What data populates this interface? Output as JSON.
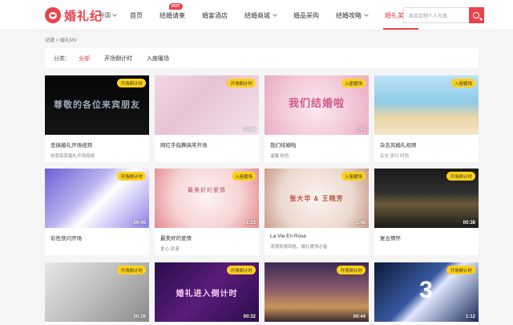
{
  "header": {
    "logo_text": "婚礼纪",
    "city": "全国",
    "nav": [
      {
        "label": "首页",
        "dropdown": false,
        "active": false,
        "hot": false
      },
      {
        "label": "结婚请柬",
        "dropdown": false,
        "active": false,
        "hot": true
      },
      {
        "label": "婚宴酒店",
        "dropdown": false,
        "active": false,
        "hot": false
      },
      {
        "label": "结婚商城",
        "dropdown": true,
        "active": false,
        "hot": false
      },
      {
        "label": "婚品采购",
        "dropdown": false,
        "active": false,
        "hot": false
      },
      {
        "label": "结婚攻略",
        "dropdown": true,
        "active": false,
        "hot": false
      },
      {
        "label": "婚礼美图",
        "dropdown": true,
        "active": true,
        "hot": false
      }
    ],
    "hot_badge": "HOT",
    "search_placeholder": "商品定制个人写真"
  },
  "breadcrumb": "动漫 > 婚礼MV",
  "filter": {
    "label": "分类：",
    "options": [
      "全部",
      "开场倒计时",
      "入座暖场"
    ],
    "active_index": 0
  },
  "cards": [
    {
      "title": "恶搞婚礼开场视频",
      "tags": "创意搞笑婚礼开场视频",
      "tag": "开场倒计时",
      "duration": "",
      "overlay": "尊敬的各位来宾朋友"
    },
    {
      "title": "网红手指舞搞笑开场",
      "tags": "",
      "tag": "开场倒计时",
      "duration": "00:46",
      "overlay": ""
    },
    {
      "title": "我们结婚啦",
      "tags": "温馨 粉色",
      "tag": "入座暖场",
      "duration": "1:47",
      "overlay": "我们结婚啦"
    },
    {
      "title": "杂志风婚礼视频",
      "tags": "杂志 流行 时尚",
      "tag": "入座暖场",
      "duration": "",
      "overlay": ""
    },
    {
      "title": "彩色快闪开场",
      "tags": "",
      "tag": "开场倒计时",
      "duration": "00:45",
      "overlay": ""
    },
    {
      "title": "最美好的爱情",
      "tags": "爱心 浪漫",
      "tag": "入座暖场",
      "duration": "1:23",
      "overlay": "最美好的爱情"
    },
    {
      "title": "La Vie En Rose",
      "tags": "浪漫玫瑰风格，婚礼暖场必备",
      "tag": "入座暖场",
      "duration": "1:46",
      "overlay": "张大华 & 王晓芳"
    },
    {
      "title": "复古情怀",
      "tags": "",
      "tag": "开场倒计时",
      "duration": "00:38",
      "overlay": ""
    },
    {
      "title": "",
      "tags": "",
      "tag": "开场倒计时",
      "duration": "00:26",
      "overlay": ""
    },
    {
      "title": "",
      "tags": "",
      "tag": "开场倒计时",
      "duration": "00:32",
      "overlay": "婚礼进入倒计时"
    },
    {
      "title": "",
      "tags": "",
      "tag": "开场倒计时",
      "duration": "00:44",
      "overlay": ""
    },
    {
      "title": "",
      "tags": "",
      "tag": "开场倒计时",
      "duration": "1:12",
      "overlay": "3"
    }
  ],
  "colors": {
    "accent": "#e9434b",
    "tag_bg": "#ffd21a"
  }
}
